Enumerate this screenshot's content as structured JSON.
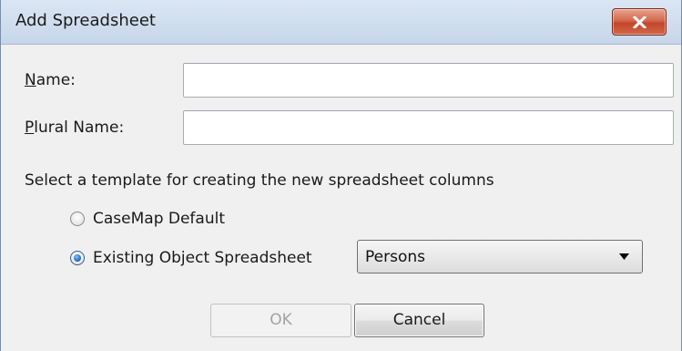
{
  "window": {
    "title": "Add Spreadsheet",
    "close_icon": "close-icon"
  },
  "form": {
    "name_label_underlined": "N",
    "name_label_rest": "ame:",
    "name_value": "",
    "plural_label_underlined": "P",
    "plural_label_rest": "lural Name:",
    "plural_value": ""
  },
  "template": {
    "prompt": "Select a template for creating the new spreadsheet columns",
    "options": [
      {
        "label": "CaseMap Default",
        "selected": false
      },
      {
        "label": "Existing Object Spreadsheet",
        "selected": true
      }
    ],
    "object_select_value": "Persons"
  },
  "buttons": {
    "ok_label": "OK",
    "ok_enabled": false,
    "cancel_label": "Cancel"
  },
  "colors": {
    "close_button": "#c4452b",
    "radio_selected": "#1e62b8",
    "disabled_text": "#a3a3a3"
  }
}
